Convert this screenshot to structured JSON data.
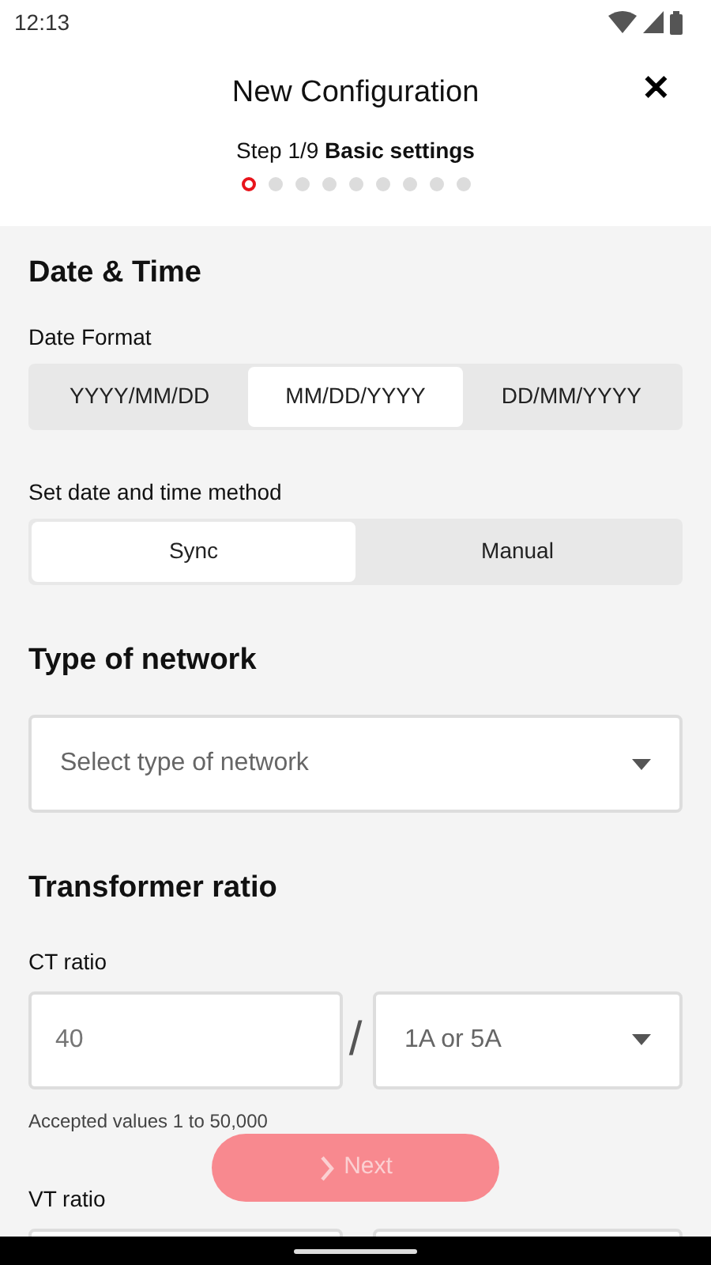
{
  "status_bar": {
    "time": "12:13"
  },
  "header": {
    "title": "New Configuration",
    "close": "✕",
    "step": "Step 1/9",
    "step_name": "Basic settings"
  },
  "steps": [
    {
      "selected": true
    },
    {
      "selected": false
    },
    {
      "selected": false
    },
    {
      "selected": false
    },
    {
      "selected": false
    },
    {
      "selected": false
    },
    {
      "selected": false
    },
    {
      "selected": false
    },
    {
      "selected": false
    }
  ],
  "date_time": {
    "title": "Date & Time",
    "date_format": {
      "label": "Date Format",
      "options": [
        {
          "label": "YYYY/MM/DD",
          "selected": false
        },
        {
          "label": "MM/DD/YYYY",
          "selected": true
        },
        {
          "label": "DD/MM/YYYY",
          "selected": false
        }
      ]
    },
    "method": {
      "label": "Set date and time method",
      "options": [
        {
          "label": "Sync",
          "selected": true
        },
        {
          "label": "Manual",
          "selected": false
        }
      ]
    }
  },
  "network": {
    "title": "Type of network",
    "placeholder": "Select type of network"
  },
  "transformer": {
    "title": "Transformer ratio",
    "ct": {
      "label": "CT ratio",
      "placeholder": "40",
      "separator": "/",
      "select": "1A or 5A",
      "hint": "Accepted values 1 to 50,000"
    },
    "vt": {
      "label": "VT ratio"
    }
  },
  "next_button": {
    "label": "Next",
    "disabled": true
  }
}
